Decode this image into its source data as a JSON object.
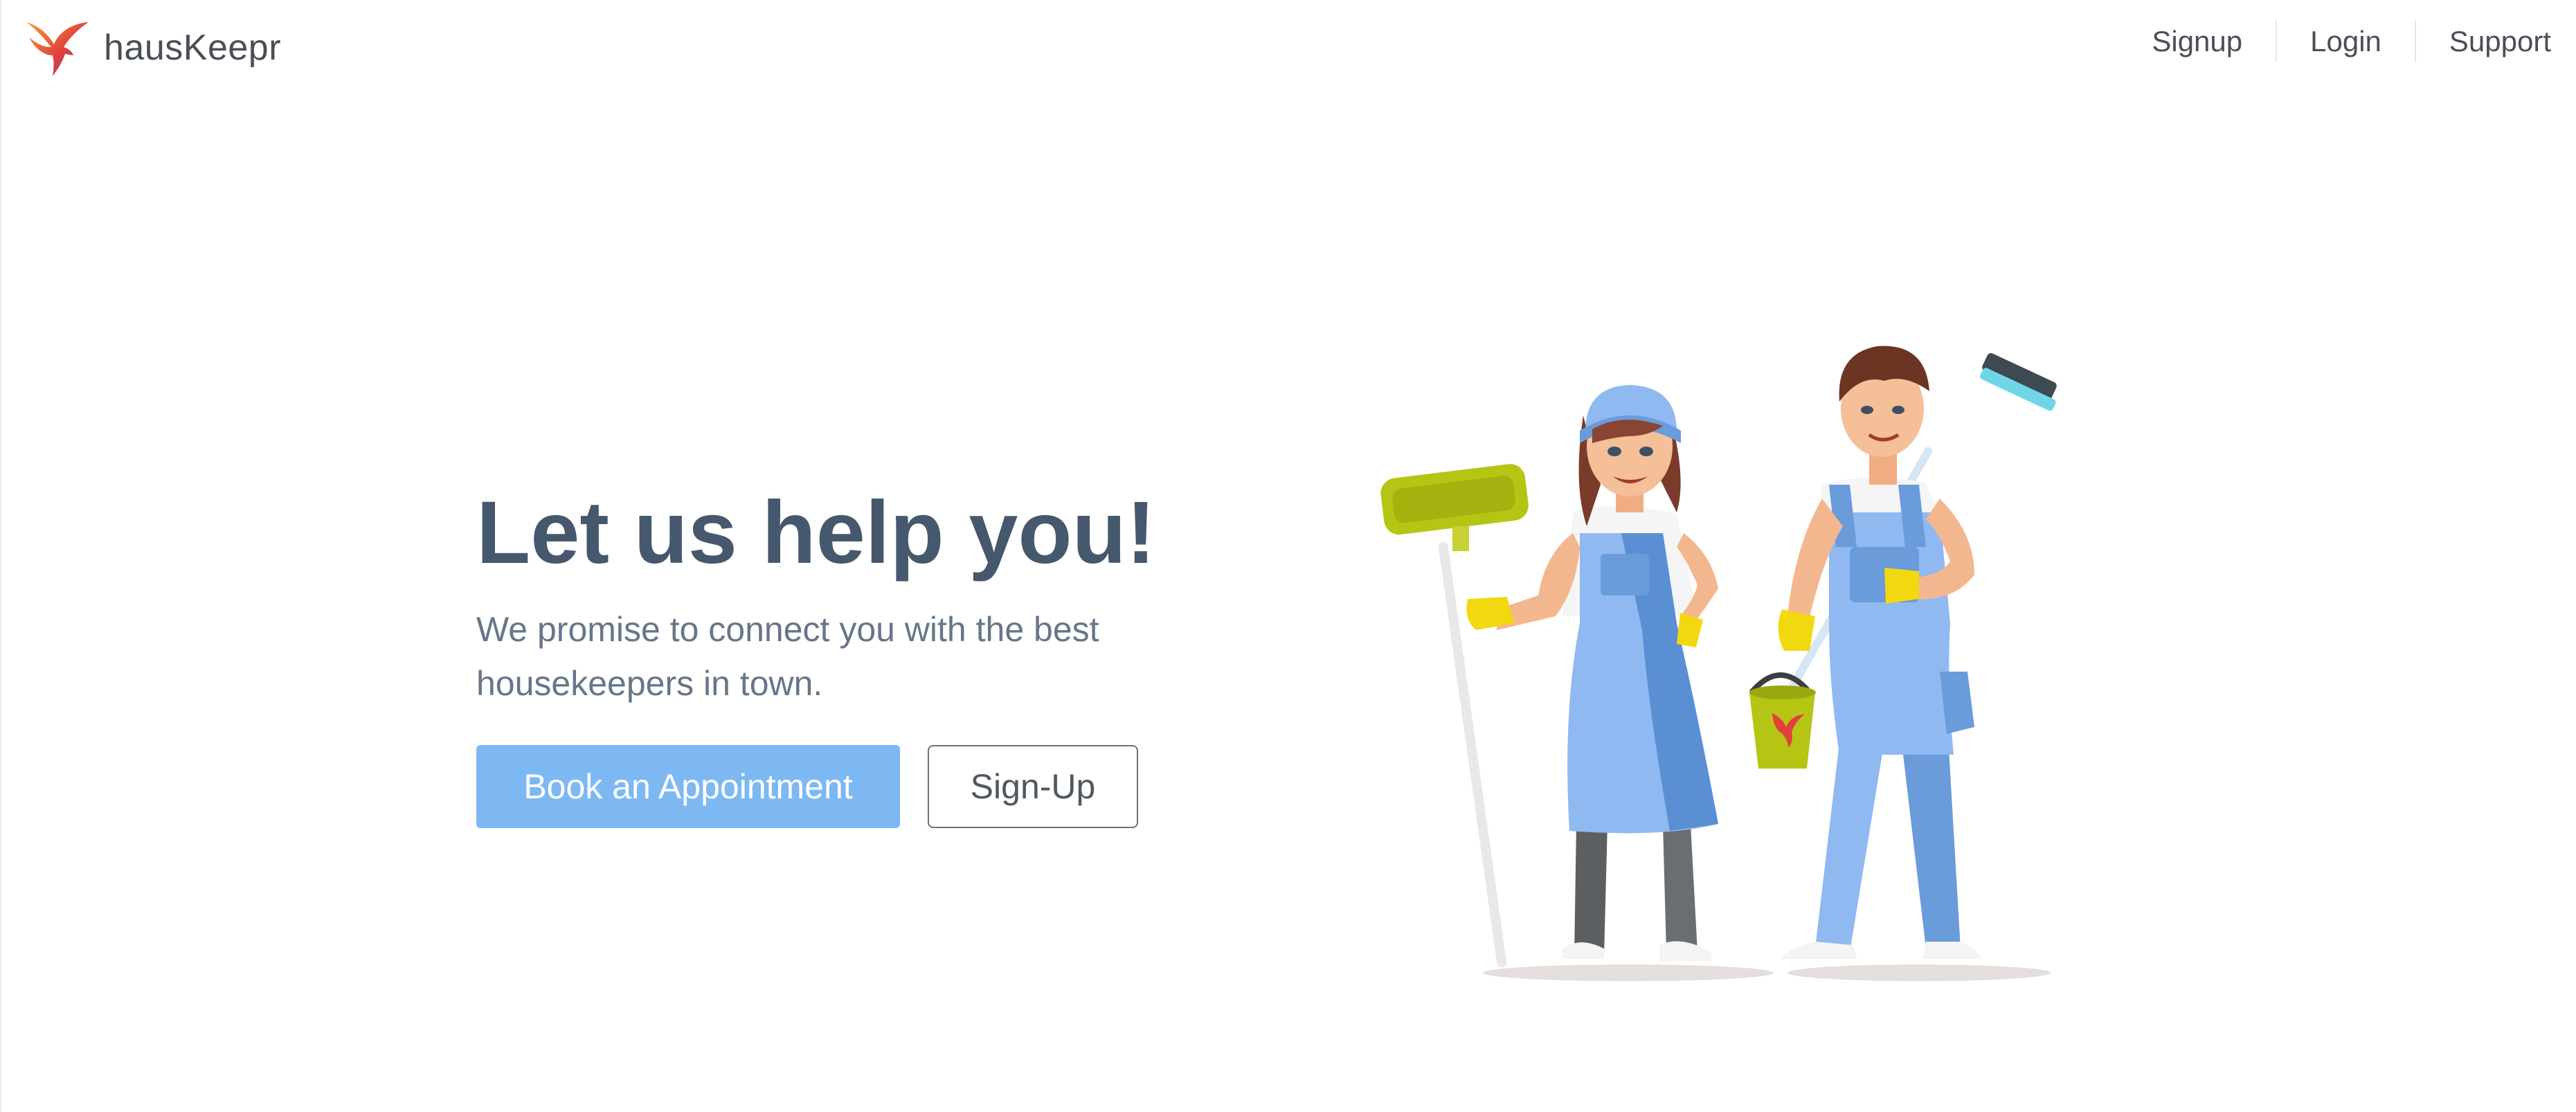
{
  "header": {
    "brand_name": "hausKeepr",
    "logo_icon": "hummingbird-logo-icon",
    "nav": [
      {
        "label": "Signup"
      },
      {
        "label": "Login"
      },
      {
        "label": "Support"
      }
    ]
  },
  "hero": {
    "title": "Let us help you!",
    "subtitle": "We promise to connect you with the best housekeepers in town.",
    "primary_cta": "Book an Appointment",
    "secondary_cta": "Sign-Up",
    "illustration": "housekeepers-illustration"
  },
  "colors": {
    "title": "#45586d",
    "primary_button": "#7db8f3",
    "text_muted": "#66768a"
  }
}
